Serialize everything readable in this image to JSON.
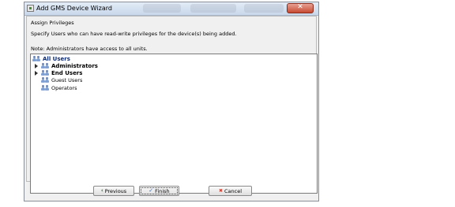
{
  "window": {
    "title": "Add GMS Device Wizard",
    "close_glyph": "✕"
  },
  "group": {
    "title": "Assign Privileges",
    "instruction": "Specify Users who can have read-write privileges for the device(s) being added.",
    "note": "Note: Administrators have access to all units."
  },
  "tree": {
    "items": [
      {
        "label": "All Users",
        "bold": true,
        "expandable": false,
        "icon": "users-icon"
      },
      {
        "label": "Administrators",
        "bold": true,
        "expandable": true,
        "icon": "users-icon"
      },
      {
        "label": "End Users",
        "bold": true,
        "expandable": true,
        "icon": "users-icon"
      },
      {
        "label": "Guest Users",
        "bold": false,
        "expandable": false,
        "icon": "users-icon"
      },
      {
        "label": "Operators",
        "bold": false,
        "expandable": false,
        "icon": "users-icon"
      }
    ]
  },
  "buttons": {
    "previous_label": "Previous",
    "previous_icon": "‹",
    "finish_label": "Finish",
    "finish_icon": "✓",
    "cancel_label": "Cancel",
    "cancel_icon": "✖"
  },
  "colors": {
    "cancel_icon": "#d04030",
    "finish_icon": "#3c6fc4",
    "previous_icon": "#2d6a2d"
  }
}
